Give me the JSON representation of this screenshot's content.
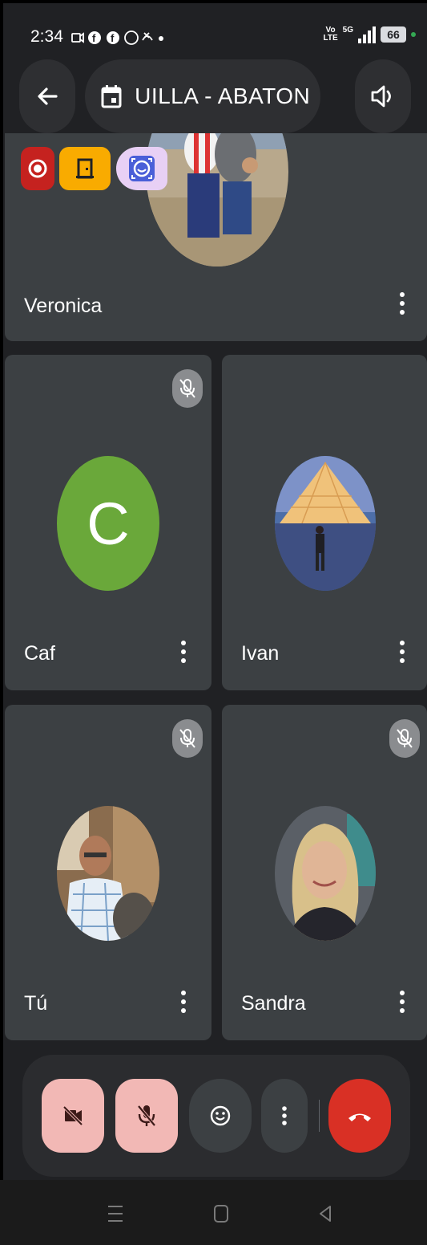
{
  "status_bar": {
    "time": "2:34",
    "notification_icons": [
      "video-call-icon",
      "facebook-icon",
      "facebook-icon",
      "whatsapp-icon",
      "missed-call-icon",
      "dot-icon"
    ],
    "volte_line1": "Vo",
    "volte_line2": "LTE",
    "network": "5G",
    "battery": "66"
  },
  "header": {
    "meeting_title": " UILLA - ABATON"
  },
  "participants": [
    {
      "name": "Veronica",
      "muted": false,
      "avatar": "photo"
    },
    {
      "name": "Caf",
      "muted": true,
      "avatar": "letter",
      "initial": "C"
    },
    {
      "name": "Ivan",
      "muted": false,
      "avatar": "photo"
    },
    {
      "name": "Tú",
      "muted": true,
      "avatar": "photo"
    },
    {
      "name": "Sandra",
      "muted": true,
      "avatar": "photo"
    }
  ],
  "colors": {
    "background": "#202124",
    "tile": "#3c4043",
    "end_call": "#d93025",
    "muted_control": "#f2b8b5",
    "letter_avatar": "#6aa83a",
    "record_chip": "#c5221f",
    "door_chip": "#f9ab00",
    "effects_chip": "#e8d0f5"
  },
  "controls": [
    "camera-off-icon",
    "mic-off-icon",
    "emoji-reaction-icon",
    "more-options-icon",
    "end-call-icon"
  ],
  "nav": [
    "recent-apps-icon",
    "home-icon",
    "back-icon"
  ]
}
